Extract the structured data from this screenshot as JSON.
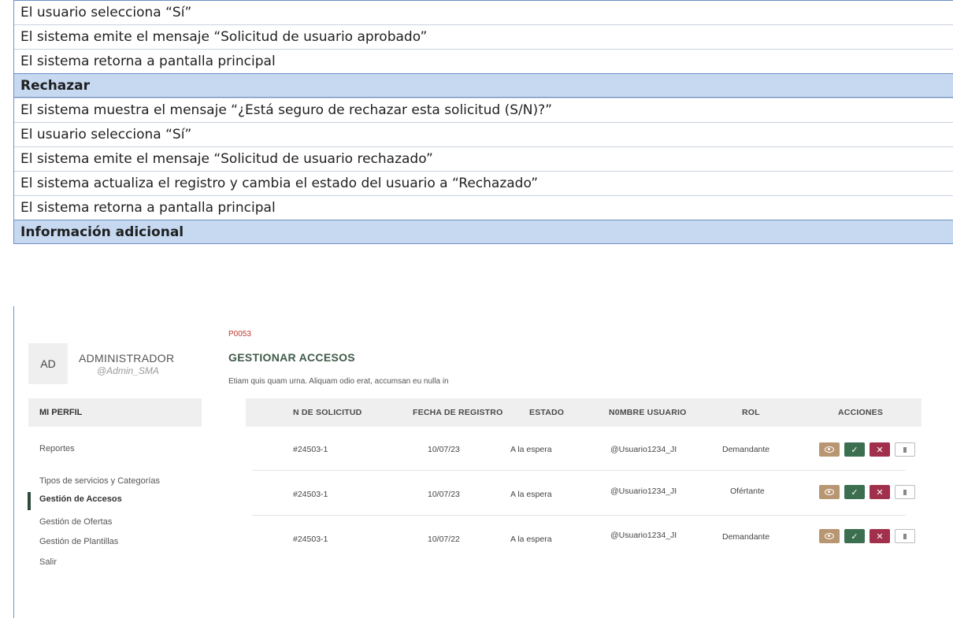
{
  "doc_rows": [
    "El usuario selecciona “Sí”",
    "El sistema emite el mensaje “Solicitud de usuario aprobado”",
    "El sistema retorna a pantalla principal",
    "Rechazar",
    "El sistema muestra el mensaje “¿Está seguro de rechazar esta solicitud (S/N)?”",
    "El usuario selecciona “Sí”",
    "El sistema emite el mensaje “Solicitud de usuario rechazado”",
    "El sistema actualiza el registro y cambia el estado del usuario a “Rechazado”",
    "El sistema retorna a pantalla principal",
    "Información adicional"
  ],
  "screen": {
    "avatar": "AD",
    "admin_name": "ADMINISTRADOR",
    "admin_handle": "@Admin_SMA",
    "profile_label": "MI PERFIL",
    "sidebar": [
      "Reportes",
      "Tipos de servicios y Categorías",
      "Gestión de Accesos",
      "Gestión de Ofertas",
      "Gestión de Plantillas",
      "Salir"
    ],
    "active_sidebar": "Gestión de Accesos",
    "code": "P0053",
    "title": "GESTIONAR ACCESOS",
    "subtitle": "Etiam quis quam urna. Aliquam odio erat, accumsan eu nulla in",
    "columns": [
      "N DE SOLICITUD",
      "FECHA DE REGISTRO",
      "ESTADO",
      "N0MBRE USUARIO",
      "ROL",
      "ACCIONES"
    ],
    "rows": [
      {
        "id": "#24503-1",
        "date": "10/07/23",
        "status": "A la espera",
        "user": "@Usuario1234_JI",
        "role": "Demandante"
      },
      {
        "id": "#24503-1",
        "date": "10/07/23",
        "status": "A la espera",
        "user": "@Usuario1234_JI",
        "role": "Ofértante"
      },
      {
        "id": "#24503-1",
        "date": "10/07/22",
        "status": "A la espera",
        "user": "@Usuario1234_JI",
        "role": "Demandante"
      }
    ],
    "icons": {
      "view": "eye-icon",
      "approve": "check-icon",
      "reject": "x-icon",
      "delete": "trash-icon"
    },
    "colors": {
      "view": "#b89672",
      "approve": "#3c6e50",
      "reject": "#a1304c",
      "title": "#3f5a48",
      "code": "#c0392b"
    }
  }
}
